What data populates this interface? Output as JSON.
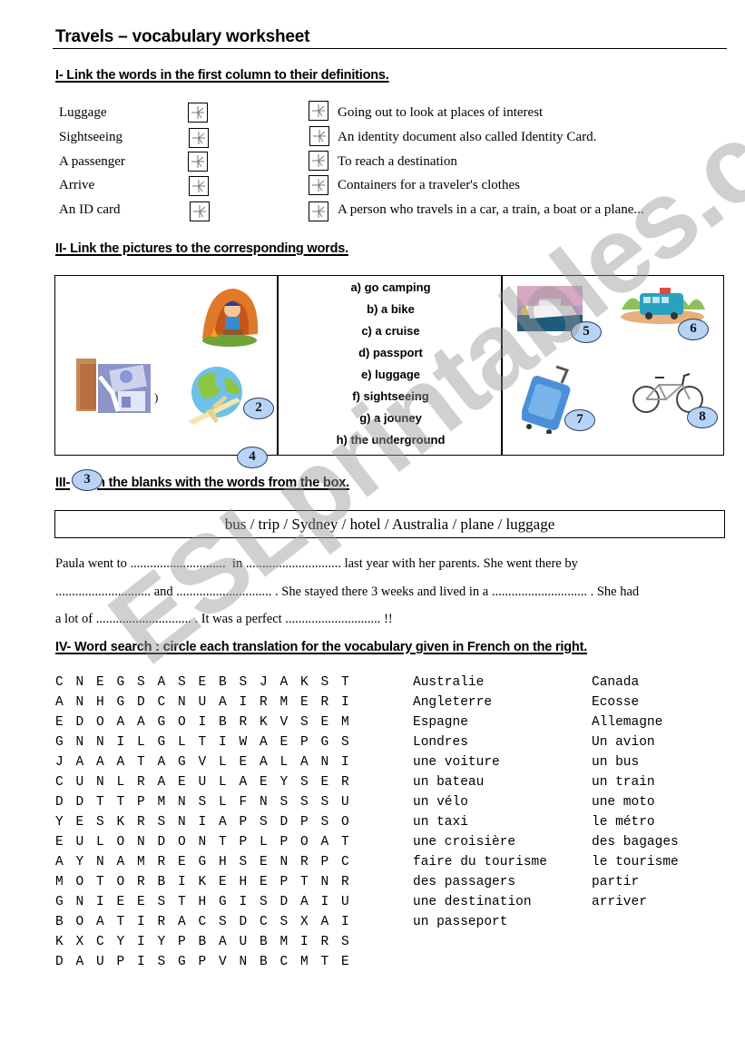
{
  "title": "Travels – vocabulary worksheet",
  "section1": {
    "heading": "I- Link the words in the first column to their definitions.",
    "words": [
      "Luggage",
      "Sightseeing",
      "A passenger",
      "Arrive",
      "An ID card"
    ],
    "definitions": [
      "Going out to look at places of interest",
      "An identity document also called Identity Card.",
      "To reach a destination",
      "Containers for a traveler's clothes",
      "A person who travels in a car, a train, a boat or a plane..."
    ],
    "link_icon": "airplane-icon"
  },
  "section2": {
    "heading": "II- Link the pictures to the corresponding words.",
    "options": [
      "a)  go camping",
      "b) a bike",
      "c) a cruise",
      "d) passport",
      "e) luggage",
      "f) sightseeing",
      "g) a jouney",
      "h) the underground"
    ],
    "pictures": [
      {
        "name": "camping-boy",
        "number": ""
      },
      {
        "name": "passport",
        "number": ""
      },
      {
        "name": "globe-airplane",
        "number": "2"
      },
      {
        "name": "cruise-ship",
        "number": "5"
      },
      {
        "name": "bus",
        "number": "6"
      },
      {
        "name": "suitcase",
        "number": "7"
      },
      {
        "name": "bicycle",
        "number": "8"
      }
    ],
    "stray_bubbles": [
      "4",
      "3"
    ]
  },
  "section3": {
    "heading": "III- Fill in the blanks with the words from the box.",
    "heading_visible_prefix": "III-",
    "heading_visible_suffix": "n the blanks with the words from the box.",
    "word_box": "bus / trip / Sydney / hotel / Australia / plane / luggage",
    "paragraph_lines": [
      "Paula went to .............................  in ............................. last year with her parents. She went there by",
      "............................. and ............................. . She stayed there 3 weeks and lived in a ............................. . She had",
      "a lot of ............................. . It was a perfect ............................. !!"
    ]
  },
  "section4": {
    "heading": "IV- Word search : circle each translation for the vocabulary given in French on the right.",
    "grid": [
      "CNEGSASEBSJAKST",
      "ANHGDCNUAIRMERI",
      "EDOAAGOIBRKVSEM",
      "GNNILGLTIWAEPGS",
      "JAAATAGVLEALANI",
      "CUNLRAEULAEYSER",
      "DDTTPMNSLFNSSSU",
      "YESKRSNIAPSDPSO",
      "EULONDONTPLPOAT",
      "AYNAMREGHSENRPC",
      "MOTORBIKEHEPTNR",
      "GNIEESTHGISDAIU",
      "BOATIRACSDCSXAI",
      "KXCYIYPBAUBMIRS",
      "DAUPISGPVNBCMTE"
    ],
    "vocab_col1": [
      "Australie",
      "Angleterre",
      "Espagne",
      "Londres",
      "une voiture",
      "un bateau",
      "un vélo",
      "un taxi",
      "une croisière",
      "faire du tourisme",
      "des passagers",
      "une destination",
      "un passeport"
    ],
    "vocab_col2": [
      "Canada",
      "Ecosse",
      "Allemagne",
      "Un avion",
      "un bus",
      "un train",
      "une moto",
      "le métro",
      "des bagages",
      "le tourisme",
      "partir",
      "arriver"
    ]
  },
  "watermark": "ESLprintables.com",
  "colors": {
    "bubble_fill": "#b7d3f5",
    "bubble_stroke": "#2c3e5a",
    "watermark": "#969696"
  }
}
